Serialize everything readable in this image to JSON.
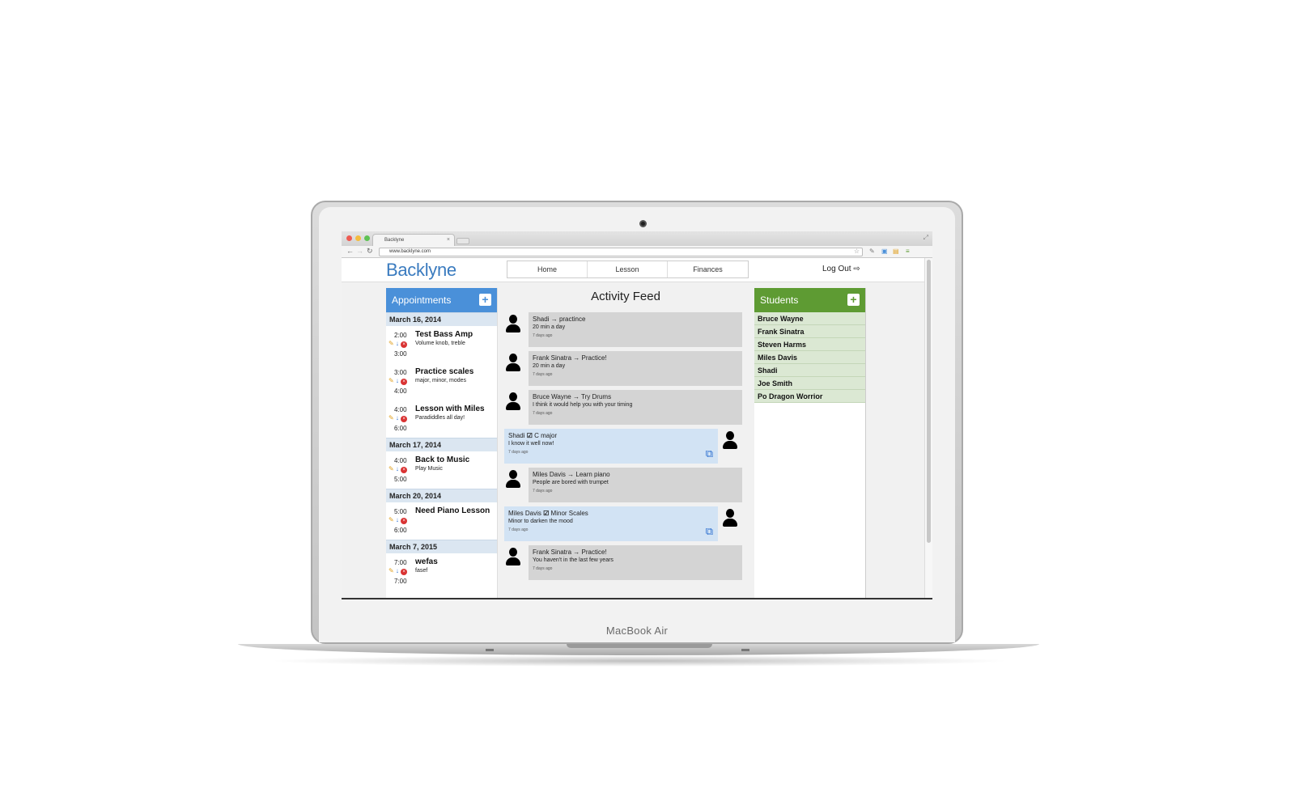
{
  "device": {
    "brand_label": "MacBook Air"
  },
  "browser": {
    "tab_title": "Backlyne",
    "url": "www.backlyne.com"
  },
  "app": {
    "logo": "Backlyne",
    "nav": [
      {
        "label": "Home"
      },
      {
        "label": "Lesson"
      },
      {
        "label": "Finances"
      }
    ],
    "logout_label": "Log Out"
  },
  "colors": {
    "appointments_header": "#4a90d9",
    "students_header": "#5e9b33",
    "logo": "#3a7bbf"
  },
  "appointments": {
    "title": "Appointments",
    "days": [
      {
        "date": "March 16, 2014",
        "items": [
          {
            "start": "2:00",
            "end": "3:00",
            "title": "Test Bass Amp",
            "note": "Volume knob, treble"
          },
          {
            "start": "3:00",
            "end": "4:00",
            "title": "Practice scales",
            "note": "major, minor, modes"
          },
          {
            "start": "4:00",
            "end": "6:00",
            "title": "Lesson with Miles",
            "note": "Paradiddles all day!"
          }
        ]
      },
      {
        "date": "March 17, 2014",
        "items": [
          {
            "start": "4:00",
            "end": "5:00",
            "title": "Back to Music",
            "note": "Play Music"
          }
        ]
      },
      {
        "date": "March 20, 2014",
        "items": [
          {
            "start": "5:00",
            "end": "6:00",
            "title": "Need Piano Lesson",
            "note": ""
          }
        ]
      },
      {
        "date": "March 7, 2015",
        "items": [
          {
            "start": "7:00",
            "end": "7:00",
            "title": "wefas",
            "note": "fasef"
          }
        ]
      }
    ]
  },
  "feed": {
    "title": "Activity Feed",
    "posts": [
      {
        "side": "left",
        "who": "Shadi",
        "marker": "→",
        "what": "practince",
        "detail": "20 min a day",
        "time": "7 days ago"
      },
      {
        "side": "left",
        "who": "Frank Sinatra",
        "marker": "→",
        "what": "Practice!",
        "detail": "20 min a day",
        "time": "7 days ago"
      },
      {
        "side": "left",
        "who": "Bruce Wayne",
        "marker": "→",
        "what": "Try Drums",
        "detail": "I think it would help you with your timing",
        "time": "7 days ago"
      },
      {
        "side": "right",
        "who": "Shadi",
        "marker": "☑",
        "what": "C major",
        "detail": "I know it well now!",
        "time": "7 days ago"
      },
      {
        "side": "left",
        "who": "Miles Davis",
        "marker": "→",
        "what": "Learn piano",
        "detail": "People are bored with trumpet",
        "time": "7 days ago"
      },
      {
        "side": "right",
        "who": "Miles Davis",
        "marker": "☑",
        "what": "Minor Scales",
        "detail": "Minor to darken the mood",
        "time": "7 days ago"
      },
      {
        "side": "left",
        "who": "Frank Sinatra",
        "marker": "→",
        "what": "Practice!",
        "detail": "You haven't in the last few years",
        "time": "7 days ago"
      }
    ]
  },
  "students": {
    "title": "Students",
    "items": [
      "Bruce Wayne",
      "Frank Sinatra",
      "Steven Harms",
      "Miles Davis",
      "Shadi",
      "Joe Smith",
      "Po Dragon Worrior"
    ]
  }
}
